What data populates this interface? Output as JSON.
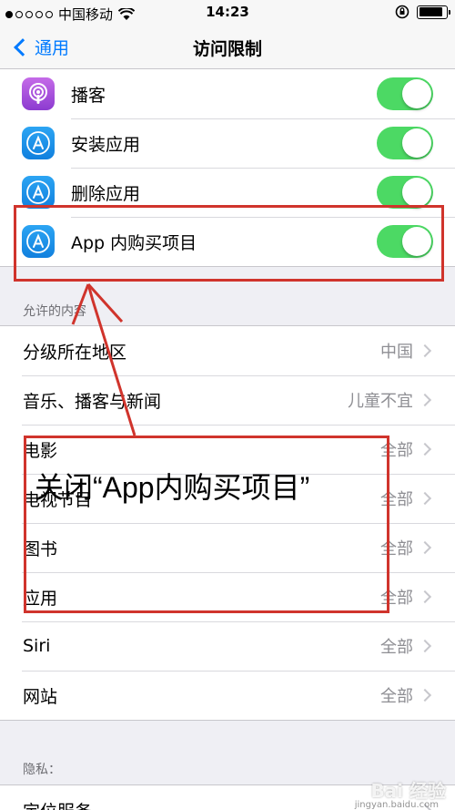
{
  "status_bar": {
    "carrier": "中国移动",
    "time": "14:23"
  },
  "nav": {
    "back_label": "通用",
    "title": "访问限制"
  },
  "app_toggles": [
    {
      "label": "播客",
      "icon": "podcast-icon",
      "on": true
    },
    {
      "label": "安装应用",
      "icon": "app-store-icon",
      "on": true
    },
    {
      "label": "删除应用",
      "icon": "app-store-icon",
      "on": true
    },
    {
      "label": "App 内购买项目",
      "icon": "app-store-icon",
      "on": true
    }
  ],
  "allowed_content": {
    "header": "允许的内容",
    "items": [
      {
        "label": "分级所在地区",
        "value": "中国"
      },
      {
        "label": "音乐、播客与新闻",
        "value": "儿童不宜"
      },
      {
        "label": "电影",
        "value": "全部"
      },
      {
        "label": "电视节目",
        "value": "全部"
      },
      {
        "label": "图书",
        "value": "全部"
      },
      {
        "label": "应用",
        "value": "全部"
      },
      {
        "label": "Siri",
        "value": "全部"
      },
      {
        "label": "网站",
        "value": "全部"
      }
    ]
  },
  "privacy": {
    "header": "隐私：",
    "items": [
      {
        "label": "定位服务"
      }
    ]
  },
  "annotation": {
    "text": "关闭“App内购买项目”"
  },
  "watermark": {
    "text": "Bai 经验",
    "url": "jingyan.baidu.com"
  },
  "colors": {
    "accent": "#007aff",
    "toggle_on": "#4cd964",
    "annotation": "#d0342c"
  }
}
